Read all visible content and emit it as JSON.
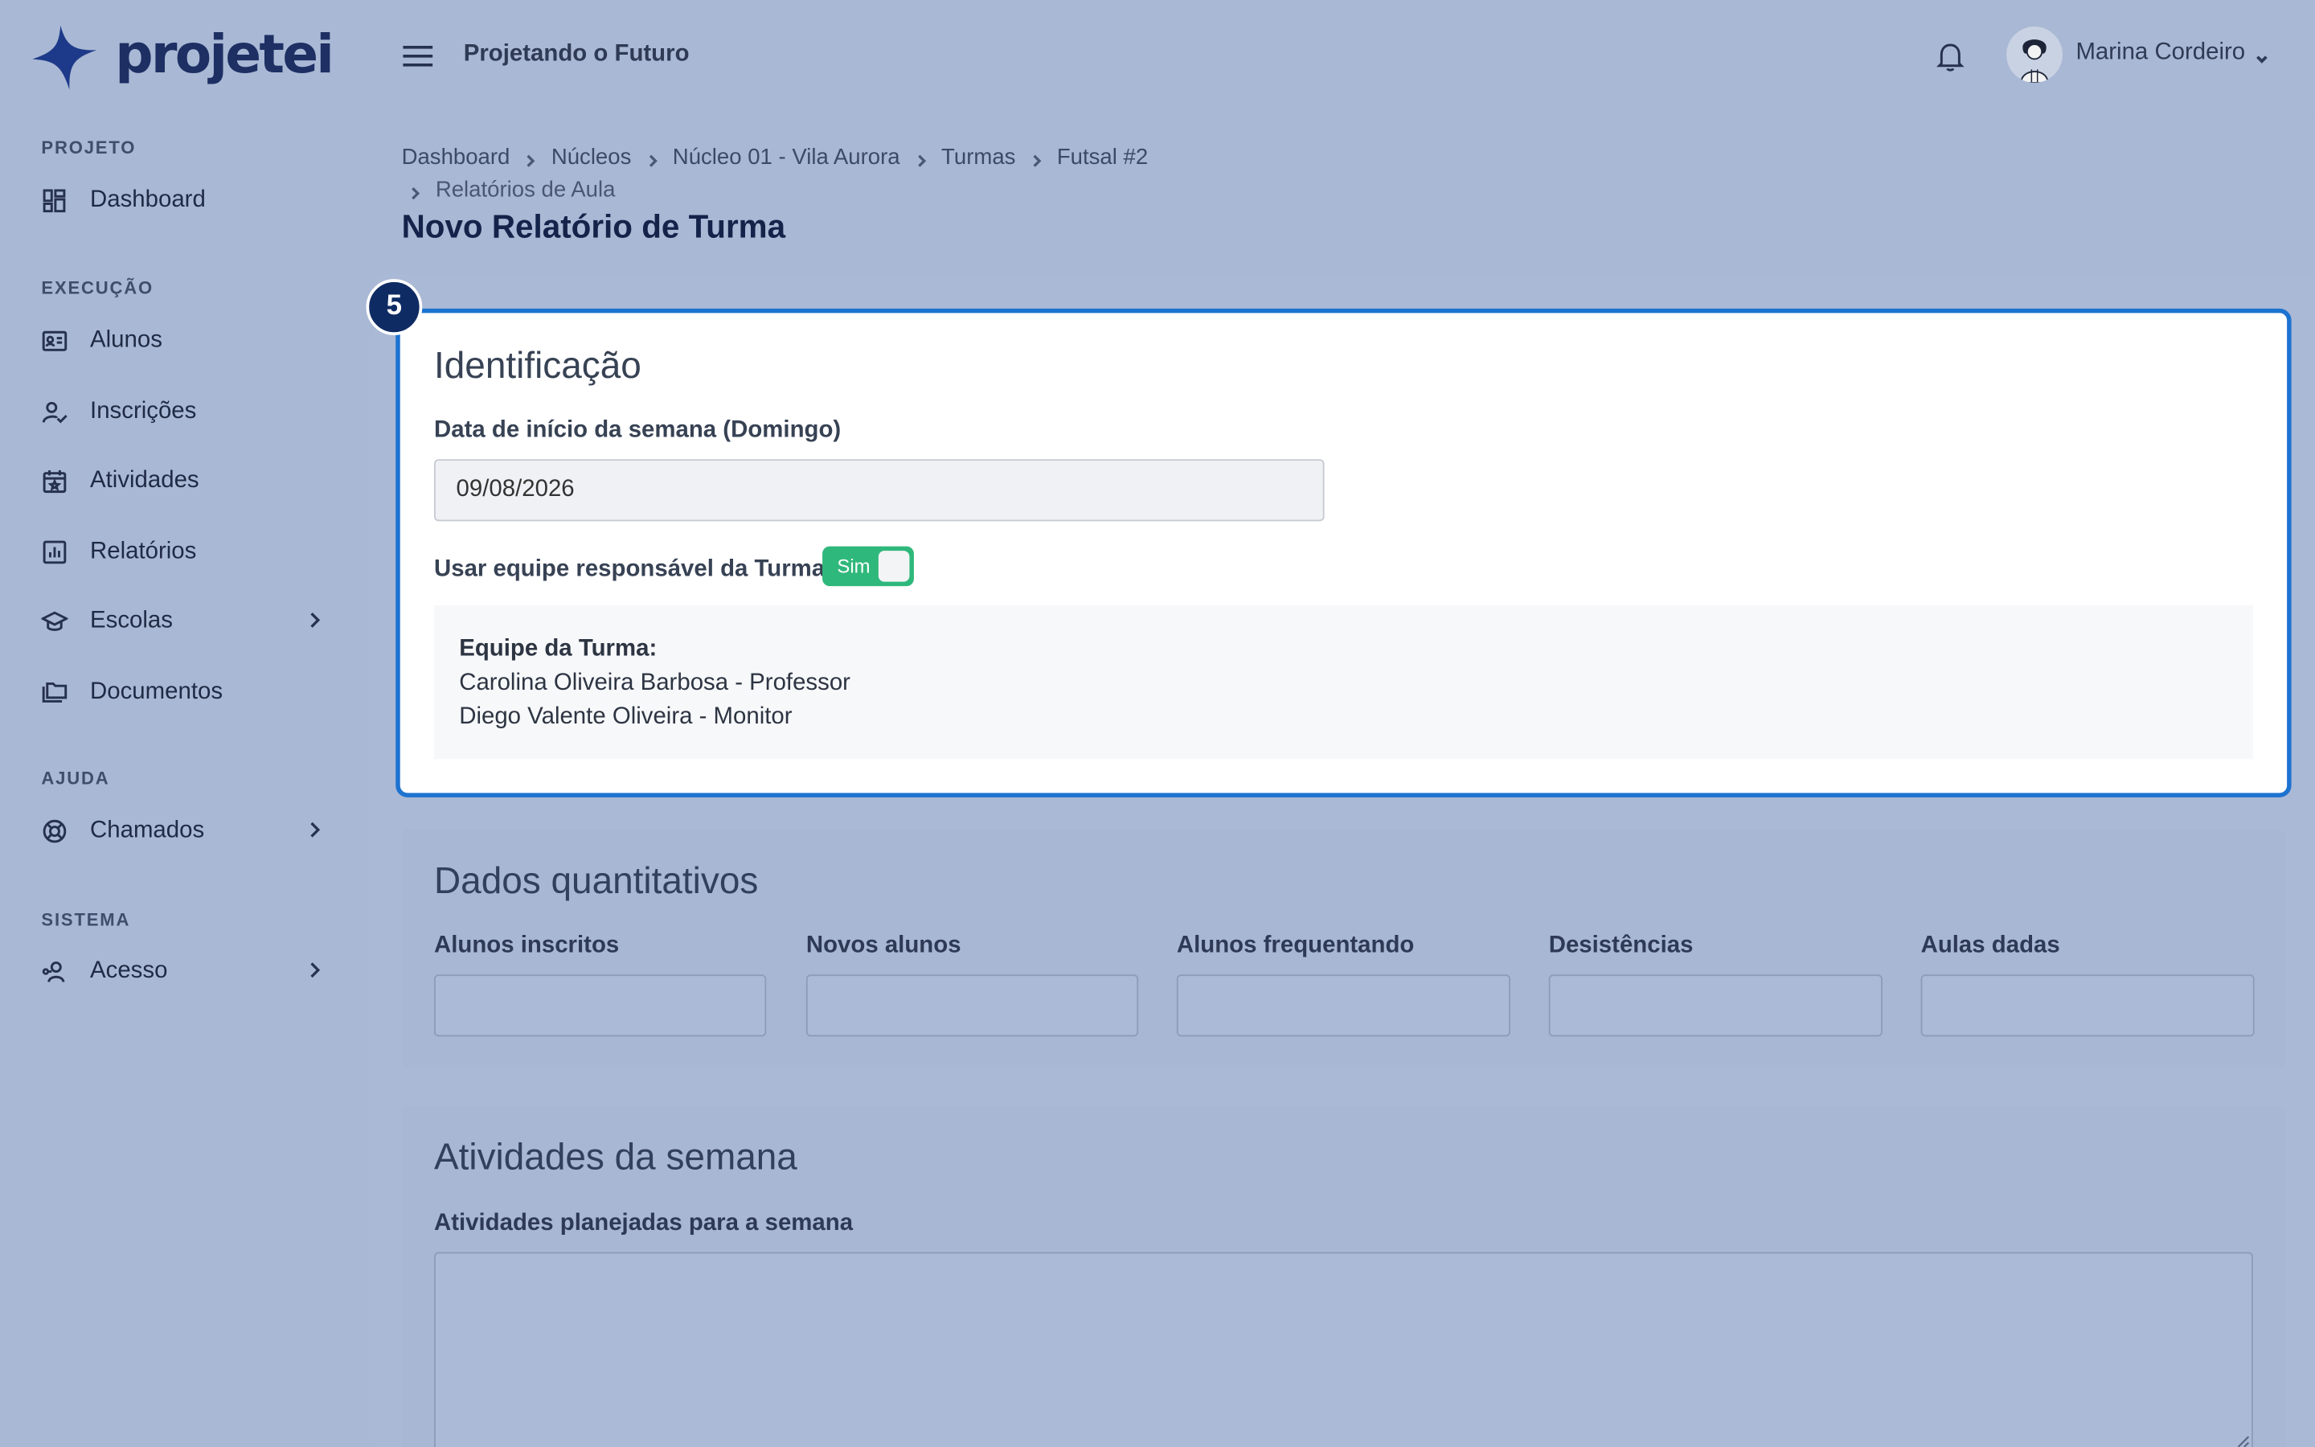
{
  "brand": {
    "name": "projetei"
  },
  "header": {
    "project_name": "Projetando o Futuro",
    "user_name": "Marina Cordeiro"
  },
  "sidebar": {
    "sections": [
      {
        "title": "PROJETO"
      },
      {
        "title": "EXECUÇÃO"
      },
      {
        "title": "AJUDA"
      },
      {
        "title": "SISTEMA"
      }
    ],
    "items": [
      {
        "label": "Dashboard",
        "icon": "dashboard-icon"
      },
      {
        "label": "Alunos",
        "icon": "id-card-icon"
      },
      {
        "label": "Inscrições",
        "icon": "user-check-icon"
      },
      {
        "label": "Atividades",
        "icon": "calendar-star-icon"
      },
      {
        "label": "Relatórios",
        "icon": "chart-icon"
      },
      {
        "label": "Escolas",
        "icon": "graduation-cap-icon"
      },
      {
        "label": "Documentos",
        "icon": "folders-icon"
      },
      {
        "label": "Chamados",
        "icon": "lifebuoy-icon"
      },
      {
        "label": "Acesso",
        "icon": "user-key-icon"
      }
    ]
  },
  "breadcrumb": {
    "items": [
      "Dashboard",
      "Núcleos",
      "Núcleo 01 - Vila Aurora",
      "Turmas",
      "Futsal #2"
    ],
    "last": "Relatórios de Aula"
  },
  "page": {
    "title": "Novo Relatório de Turma"
  },
  "step": {
    "number": "5"
  },
  "identificacao": {
    "title": "Identificação",
    "date_label": "Data de início da semana (Domingo)",
    "date_value": "09/08/2026",
    "toggle_label": "Usar equipe responsável da Turma",
    "toggle_text": "Sim",
    "team_title": "Equipe da Turma:",
    "team_members": [
      "Carolina Oliveira Barbosa - Professor",
      "Diego Valente Oliveira - Monitor"
    ]
  },
  "quantitativos": {
    "title": "Dados quantitativos",
    "fields": [
      "Alunos inscritos",
      "Novos alunos",
      "Alunos frequentando",
      "Desistências",
      "Aulas dadas"
    ]
  },
  "atividades": {
    "title": "Atividades da semana",
    "planned_label": "Atividades planejadas para a semana"
  },
  "colors": {
    "accent": "#1d73d0",
    "toggle_on": "#2fb87b",
    "badge": "#0f2b63",
    "brand": "#1d2f63"
  }
}
